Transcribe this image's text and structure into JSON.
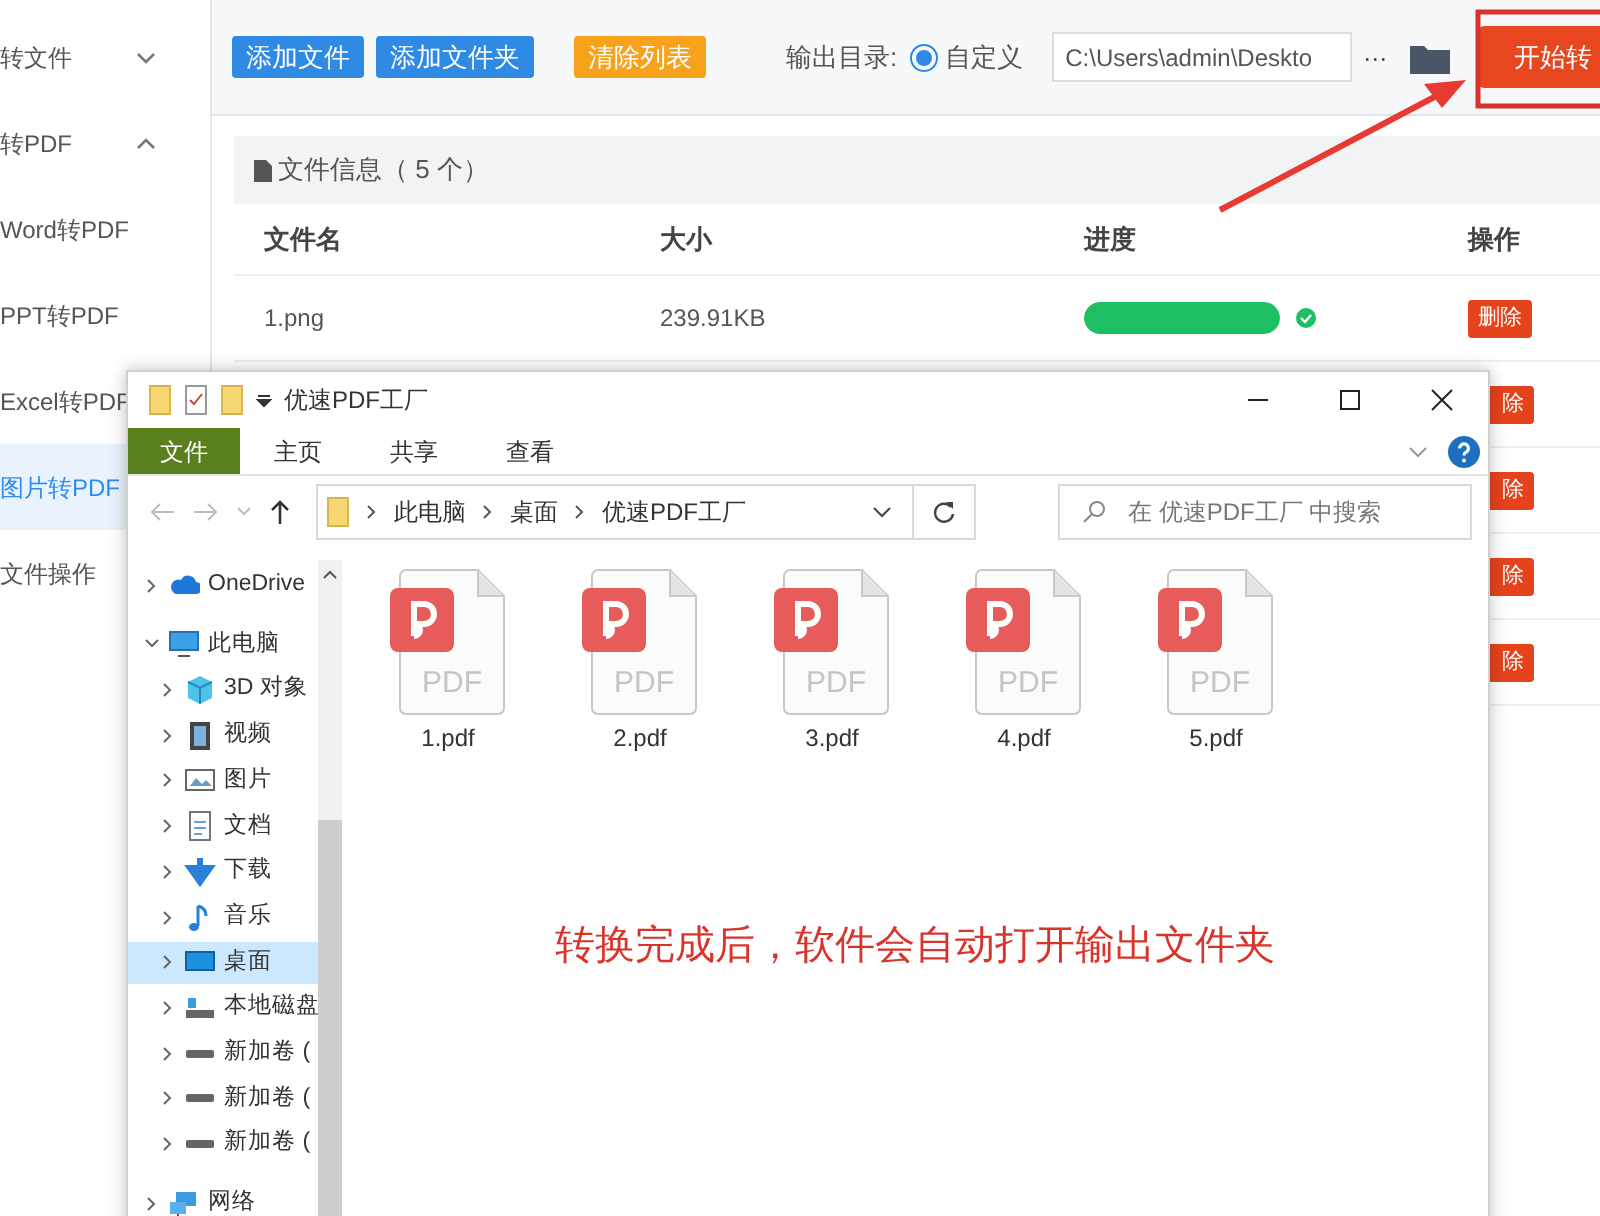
{
  "sidebar": {
    "items": [
      {
        "label": "转文件",
        "expanded": false
      },
      {
        "label": "转PDF",
        "expanded": true,
        "children": [
          {
            "label": "Word转PDF",
            "selected": false
          },
          {
            "label": "PPT转PDF",
            "selected": false
          },
          {
            "label": "Excel转PDF",
            "selected": false
          },
          {
            "label": "图片转PDF",
            "selected": true
          }
        ]
      },
      {
        "label": "文件操作"
      }
    ]
  },
  "toolbar": {
    "buttons": [
      {
        "label": "添加文件",
        "kind": "primary"
      },
      {
        "label": "添加文件夹",
        "kind": "primary"
      },
      {
        "label": "清除列表",
        "kind": "warning"
      }
    ],
    "output_label": "输出目录:",
    "radio": {
      "label": "自定义",
      "selected": true
    },
    "path": "C:\\Users\\admin\\Deskto",
    "more": "···",
    "start_button": "开始转"
  },
  "file_panel": {
    "title": "文件信息（ 5 个）",
    "columns": [
      "文件名",
      "大小",
      "进度",
      "操作"
    ],
    "rows": [
      {
        "name": "1.png",
        "size": "239.91KB",
        "level": 1,
        "done": true,
        "action": "删除"
      },
      {
        "action": "除"
      },
      {
        "action": "除"
      },
      {
        "action": "除"
      },
      {
        "action": "除"
      }
    ]
  },
  "explorer": {
    "title": "优速PDF工厂",
    "ribbon_tabs": [
      {
        "label": "文件",
        "selected": true
      },
      {
        "label": "主页",
        "selected": false
      },
      {
        "label": "共享",
        "selected": false
      },
      {
        "label": "查看",
        "selected": false
      }
    ],
    "breadcrumb": [
      "此电脑",
      "桌面",
      "优速PDF工厂"
    ],
    "search": {
      "placeholder": "在 优速PDF工厂 中搜索"
    },
    "nav": [
      {
        "label": "OneDrive",
        "kind": "cloud",
        "expanded": false,
        "selected": false
      },
      {
        "label": "此电脑",
        "kind": "pc",
        "expanded": true,
        "selected": false,
        "children": [
          {
            "label": "3D 对象",
            "kind": "cube",
            "expanded": false,
            "selected": false
          },
          {
            "label": "视频",
            "kind": "video",
            "expanded": false,
            "selected": false
          },
          {
            "label": "图片",
            "kind": "picture",
            "expanded": false,
            "selected": false
          },
          {
            "label": "文档",
            "kind": "doc",
            "expanded": false,
            "selected": false
          },
          {
            "label": "下载",
            "kind": "download",
            "expanded": false,
            "selected": false
          },
          {
            "label": "音乐",
            "kind": "music",
            "expanded": false,
            "selected": false
          },
          {
            "label": "桌面",
            "kind": "desktop",
            "expanded": false,
            "selected": true
          },
          {
            "label": "本地磁盘",
            "kind": "disk",
            "expanded": false,
            "selected": false
          },
          {
            "label": "新加卷 (",
            "kind": "drive",
            "expanded": false,
            "selected": false
          },
          {
            "label": "新加卷 (",
            "kind": "drive",
            "expanded": false,
            "selected": false
          },
          {
            "label": "新加卷 (",
            "kind": "drive",
            "expanded": false,
            "selected": false
          }
        ]
      },
      {
        "label": "网络",
        "kind": "network",
        "expanded": false,
        "selected": false
      }
    ],
    "files": [
      {
        "name": "1.pdf",
        "icon_text": "PDF"
      },
      {
        "name": "2.pdf",
        "icon_text": "PDF"
      },
      {
        "name": "3.pdf",
        "icon_text": "PDF"
      },
      {
        "name": "4.pdf",
        "icon_text": "PDF"
      },
      {
        "name": "5.pdf",
        "icon_text": "PDF"
      }
    ]
  },
  "annotation": {
    "text": "转换完成后，软件会自动打开输出文件夹"
  }
}
